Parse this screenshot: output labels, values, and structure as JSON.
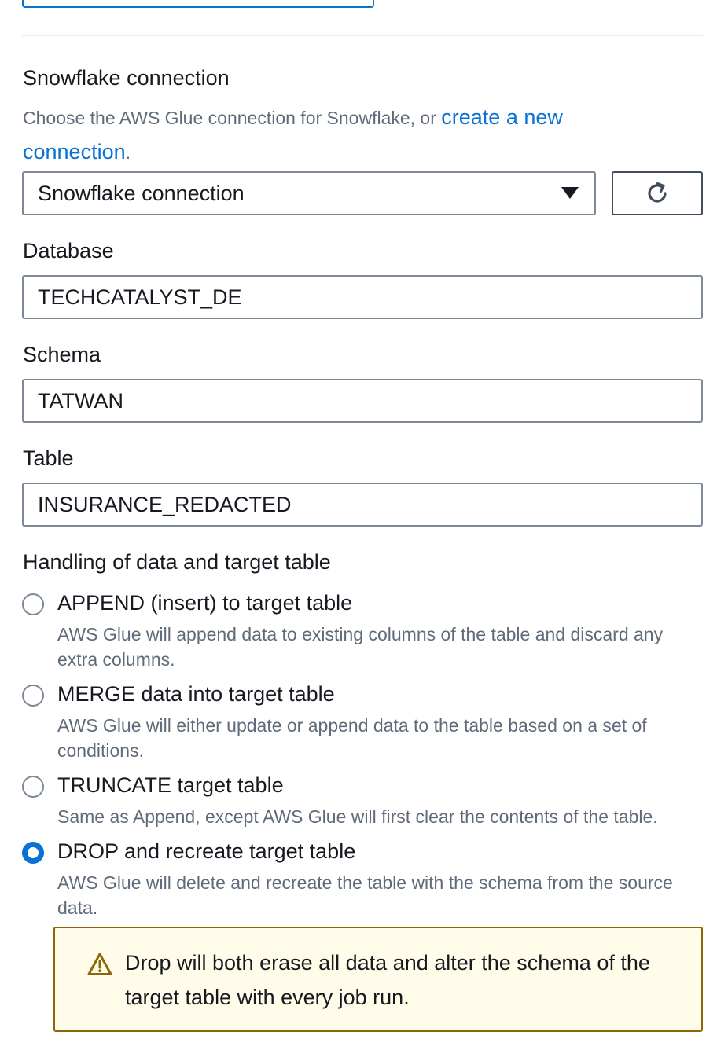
{
  "connection": {
    "label": "Snowflake connection",
    "description_prefix": "Choose the AWS Glue connection for Snowflake, or ",
    "create_link": "create a new connection",
    "description_suffix": ".",
    "selected": "Snowflake connection",
    "refresh_icon": "refresh-icon"
  },
  "database": {
    "label": "Database",
    "value": "TECHCATALYST_DE"
  },
  "schema": {
    "label": "Schema",
    "value": "TATWAN"
  },
  "table": {
    "label": "Table",
    "value": "INSURANCE_REDACTED"
  },
  "handling": {
    "label": "Handling of data and target table",
    "options": [
      {
        "label": "APPEND (insert) to target table",
        "description": "AWS Glue will append data to existing columns of the table and discard any extra columns.",
        "checked": false
      },
      {
        "label": "MERGE data into target table",
        "description": "AWS Glue will either update or append data to the table based on a set of conditions.",
        "checked": false
      },
      {
        "label": "TRUNCATE target table",
        "description": "Same as Append, except AWS Glue will first clear the contents of the table.",
        "checked": false
      },
      {
        "label": "DROP and recreate target table",
        "description": "AWS Glue will delete and recreate the table with the schema from the source data.",
        "checked": true
      }
    ],
    "warning": {
      "icon": "warning-icon",
      "text": "Drop will both erase all data and alter the schema of the target table with every job run."
    }
  },
  "colors": {
    "accent": "#0972d3",
    "text": "#16191f",
    "secondary_text": "#5f6b7a",
    "border": "#7d8998",
    "warning_bg": "#fffce9",
    "warning_border": "#8d6605"
  }
}
